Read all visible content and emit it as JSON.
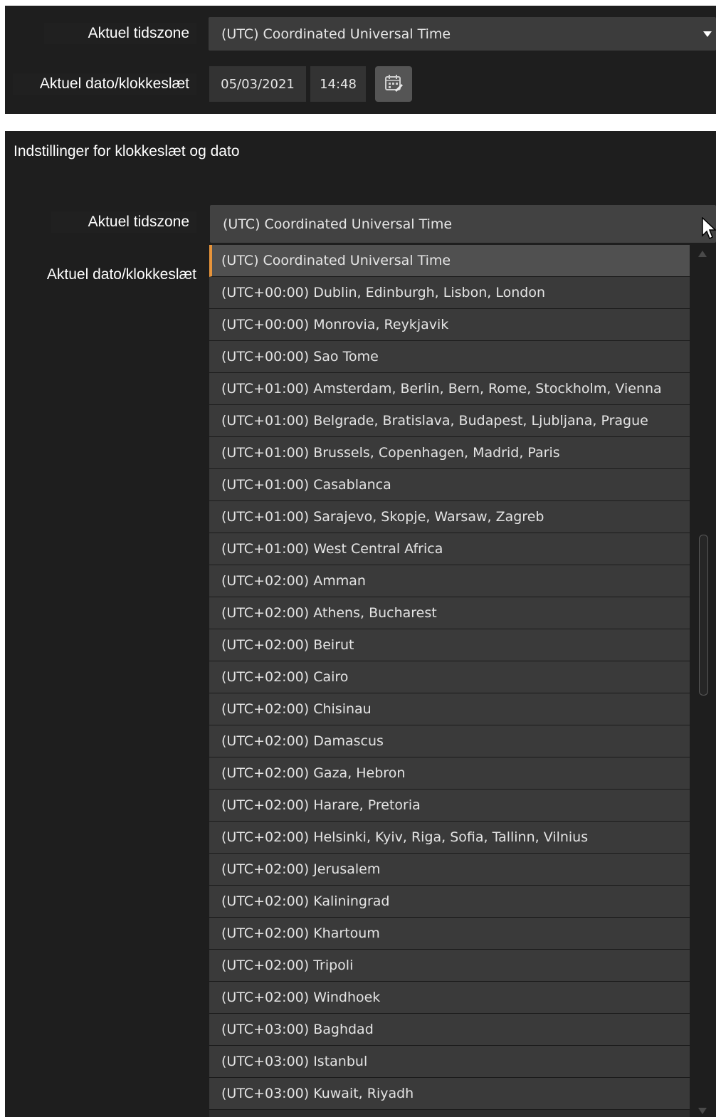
{
  "top_panel": {
    "timezone_label": "Aktuel tidszone",
    "timezone_value": "(UTC) Coordinated Universal Time",
    "datetime_label": "Aktuel dato/klokkeslæt",
    "date_value": "05/03/2021",
    "time_value": "14:48"
  },
  "settings_panel": {
    "title": "Indstillinger for klokkeslæt og dato",
    "timezone_label": "Aktuel tidszone",
    "timezone_value": "(UTC) Coordinated Universal Time",
    "datetime_label": "Aktuel dato/klokkeslæt"
  },
  "dropdown": {
    "selected_index": 0,
    "accent_color": "#e8943a",
    "options": [
      "(UTC) Coordinated Universal Time",
      "(UTC+00:00) Dublin, Edinburgh, Lisbon, London",
      "(UTC+00:00) Monrovia, Reykjavik",
      "(UTC+00:00) Sao Tome",
      "(UTC+01:00) Amsterdam, Berlin, Bern, Rome, Stockholm, Vienna",
      "(UTC+01:00) Belgrade, Bratislava, Budapest, Ljubljana, Prague",
      "(UTC+01:00) Brussels, Copenhagen, Madrid, Paris",
      "(UTC+01:00) Casablanca",
      "(UTC+01:00) Sarajevo, Skopje, Warsaw, Zagreb",
      "(UTC+01:00) West Central Africa",
      "(UTC+02:00) Amman",
      "(UTC+02:00) Athens, Bucharest",
      "(UTC+02:00) Beirut",
      "(UTC+02:00) Cairo",
      "(UTC+02:00) Chisinau",
      "(UTC+02:00) Damascus",
      "(UTC+02:00) Gaza, Hebron",
      "(UTC+02:00) Harare, Pretoria",
      "(UTC+02:00) Helsinki, Kyiv, Riga, Sofia, Tallinn, Vilnius",
      "(UTC+02:00) Jerusalem",
      "(UTC+02:00) Kaliningrad",
      "(UTC+02:00) Khartoum",
      "(UTC+02:00) Tripoli",
      "(UTC+02:00) Windhoek",
      "(UTC+03:00) Baghdad",
      "(UTC+03:00) Istanbul",
      "(UTC+03:00) Kuwait, Riyadh"
    ]
  }
}
